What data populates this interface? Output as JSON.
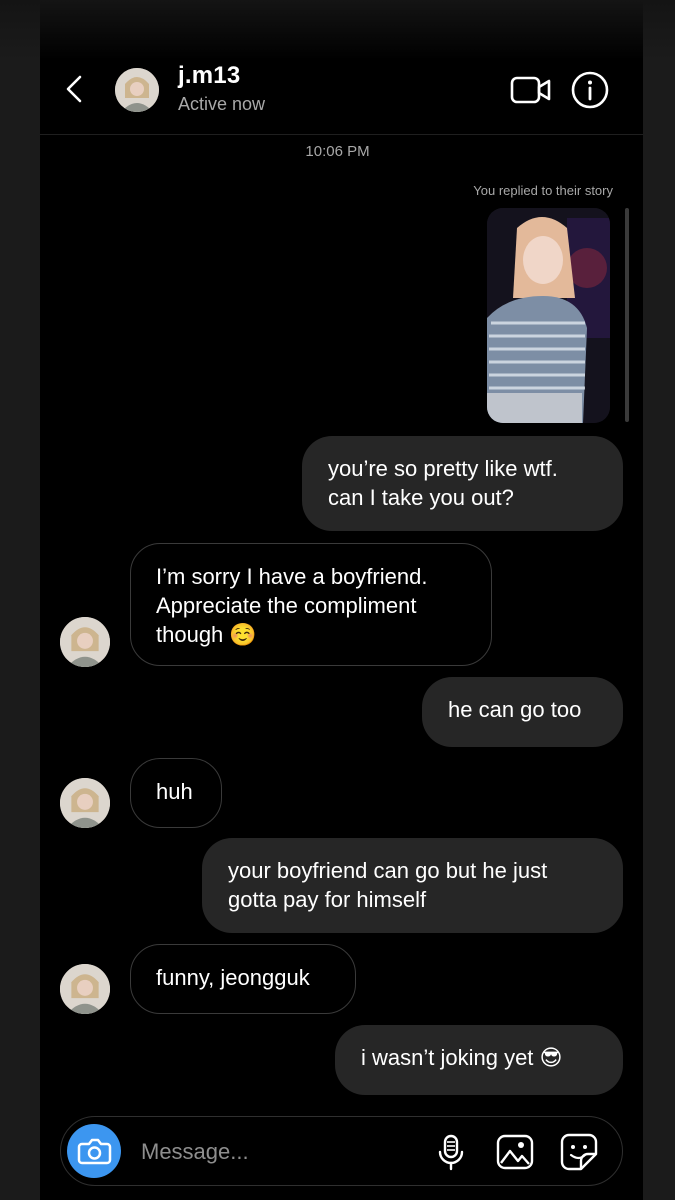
{
  "header": {
    "username": "j.m13",
    "status": "Active now"
  },
  "thread": {
    "timestamp": "10:06 PM",
    "story_reply_note": "You replied to their story",
    "messages": [
      {
        "from": "me",
        "text": "you’re so pretty like wtf. can I take you out?"
      },
      {
        "from": "them",
        "text": "I’m sorry I have a boyfriend. Appreciate the compliment though ☺️"
      },
      {
        "from": "me",
        "text": "he can go too"
      },
      {
        "from": "them",
        "text": "huh"
      },
      {
        "from": "me",
        "text": "your boyfriend can go but he just gotta pay for himself"
      },
      {
        "from": "them",
        "text": "funny, jeongguk"
      },
      {
        "from": "me",
        "text": "i wasn’t joking yet 😎"
      }
    ]
  },
  "composer": {
    "placeholder": "Message..."
  },
  "icons": {
    "back": "chevron-left-icon",
    "video": "video-camera-icon",
    "info": "info-icon",
    "camera": "camera-icon",
    "mic": "microphone-icon",
    "gallery": "image-gallery-icon",
    "sticker": "sticker-icon"
  },
  "colors": {
    "background": "#000000",
    "outgoing_bubble": "#262626",
    "incoming_border": "#3a3a3a",
    "camera_button": "#3c96f0",
    "secondary_text": "#a8a8a8"
  }
}
